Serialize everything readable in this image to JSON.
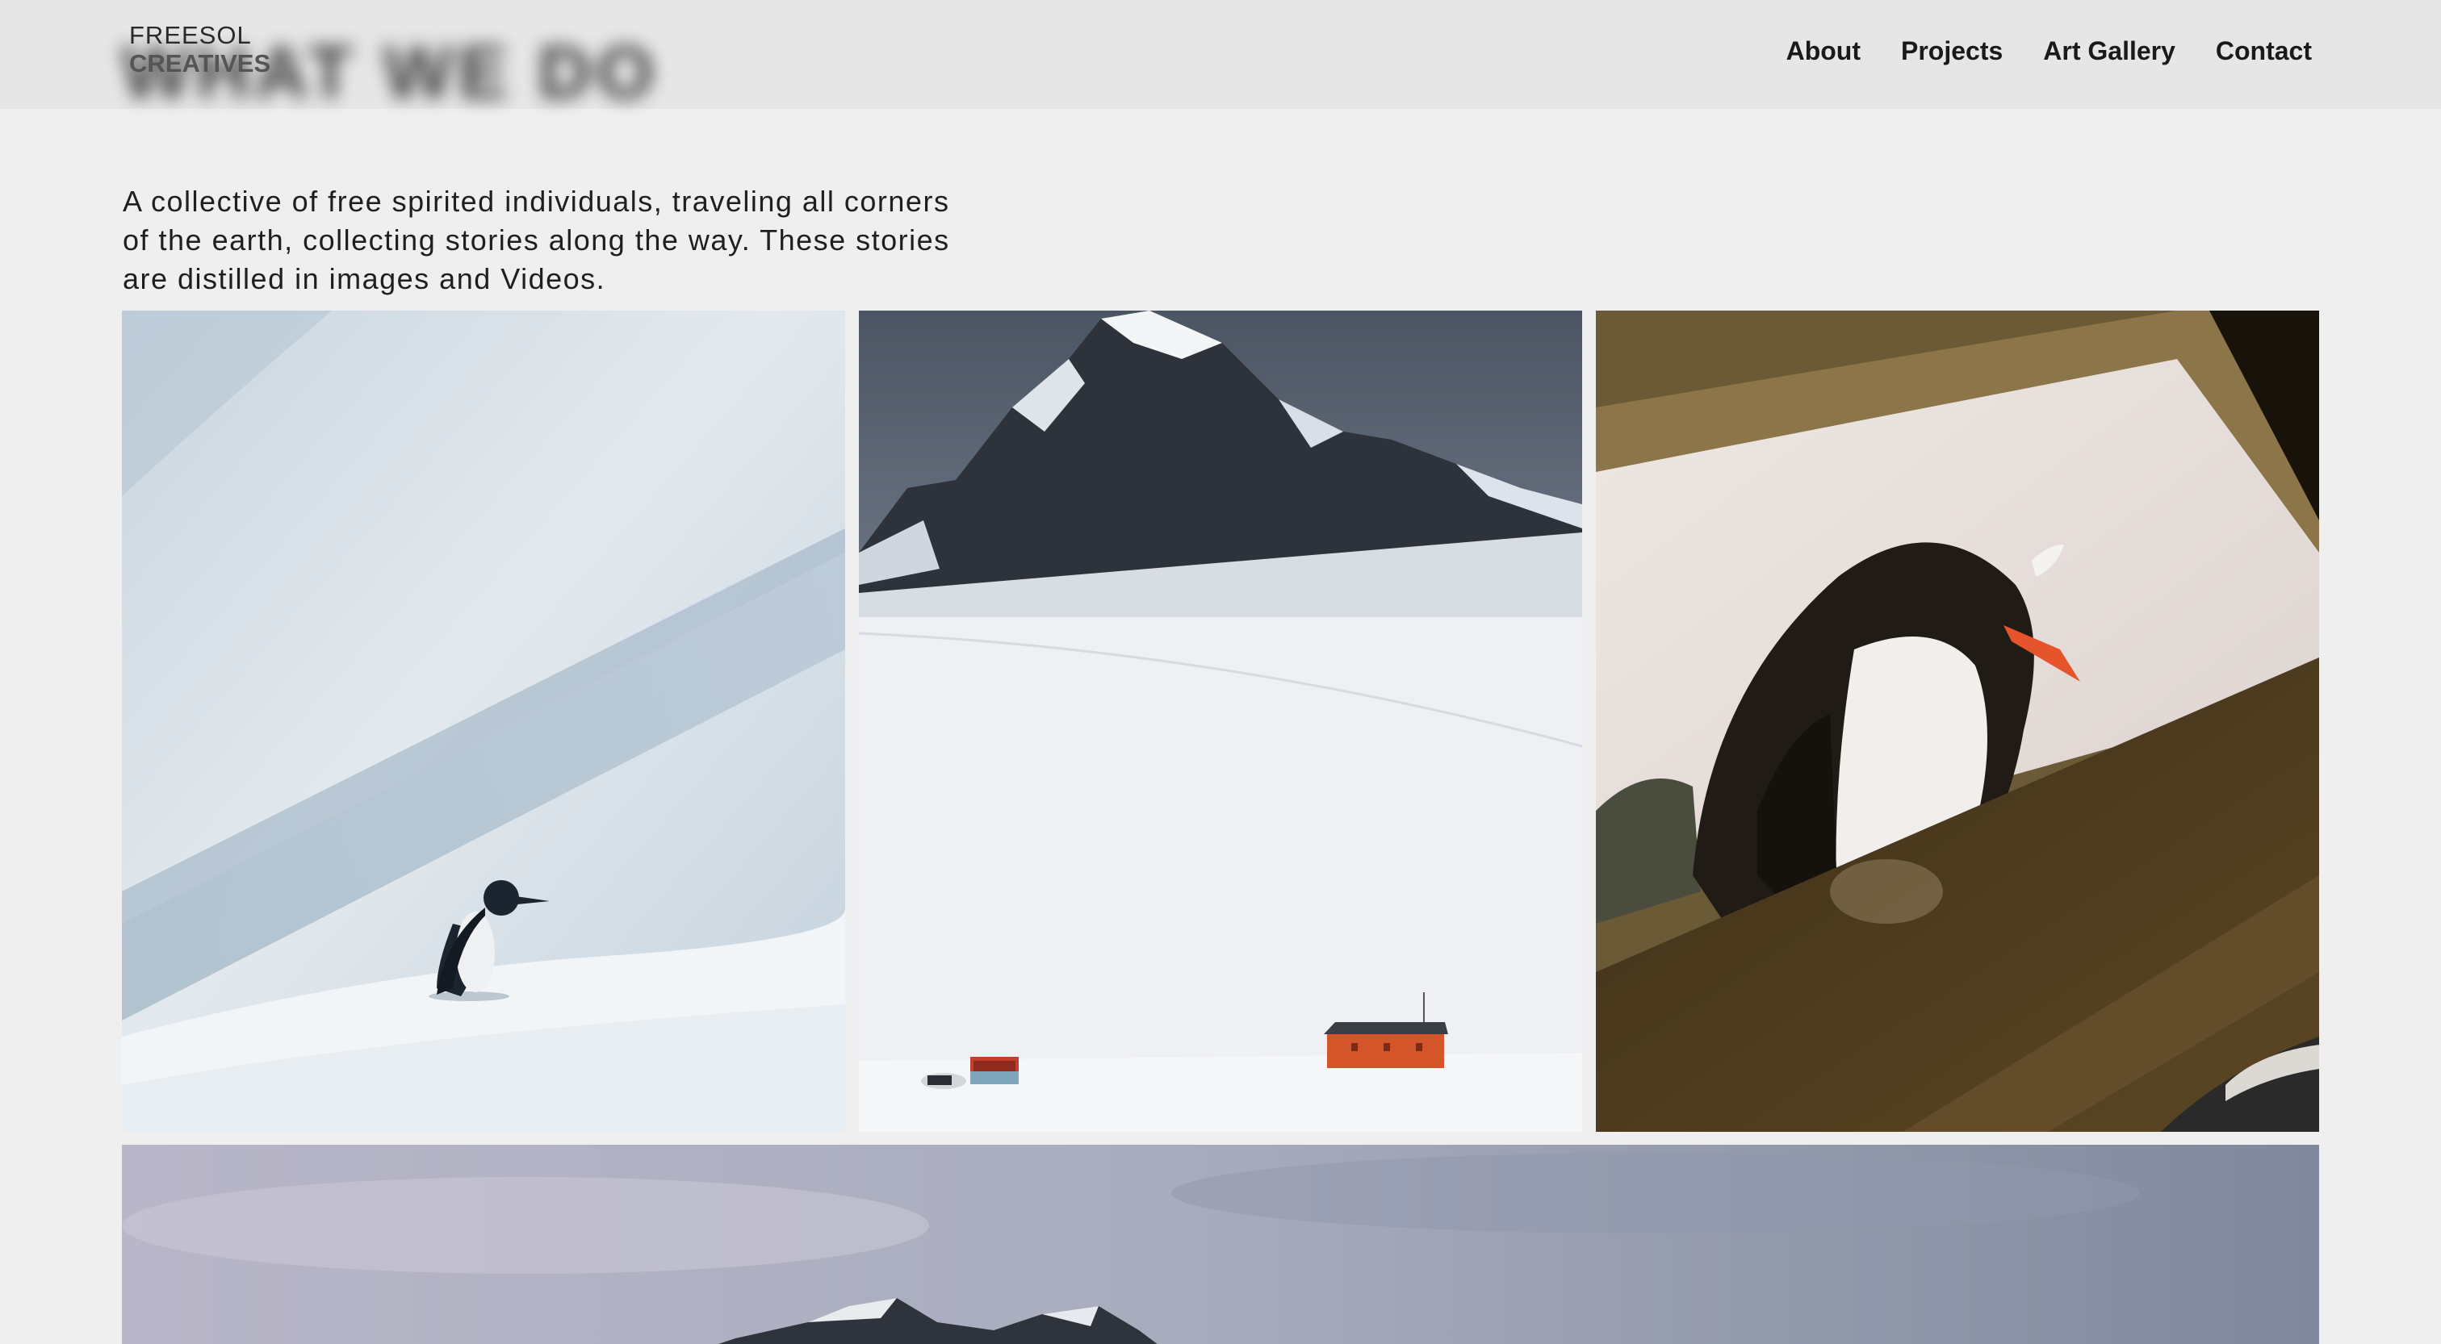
{
  "header": {
    "ghost_title": "WHAT WE DO",
    "logo": {
      "line1": "FREESOL",
      "line2": "CREATIVES"
    },
    "nav": [
      {
        "label": "About"
      },
      {
        "label": "Projects"
      },
      {
        "label": "Art Gallery"
      },
      {
        "label": "Contact"
      }
    ]
  },
  "intro": {
    "text": "A collective of free spirited individuals, traveling all corners of the earth, collecting stories along the way. These stories are distilled in images and Videos."
  },
  "colors": {
    "background": "#efefef",
    "header": "#e5e5e5",
    "text": "#1d1d1d",
    "hut_orange": "#d4552a"
  }
}
